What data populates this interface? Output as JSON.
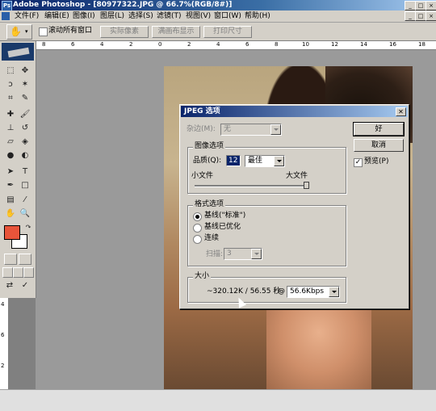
{
  "window": {
    "title": "Adobe Photoshop - [80977322.JPG @ 66.7%(RGB/8#)]"
  },
  "menu": [
    "文件(F)",
    "编辑(E)",
    "图像(I)",
    "图层(L)",
    "选择(S)",
    "滤镜(T)",
    "视图(V)",
    "窗口(W)",
    "帮助(H)"
  ],
  "options": {
    "scroll_all_label": "滚动所有窗口",
    "actual_pixels": "实际像素",
    "fit_on_screen": "满画布显示",
    "print_size": "打印尺寸"
  },
  "ruler": {
    "h_labels": [
      "8",
      "6",
      "4",
      "2",
      "0",
      "2",
      "4",
      "6",
      "8",
      "10",
      "12",
      "14",
      "16",
      "18"
    ],
    "v_labels": [
      "4",
      "6",
      "2"
    ]
  },
  "colors": {
    "foreground": "#e8543a",
    "background": "#ffffff"
  },
  "dialog": {
    "title": "JPEG 选项",
    "matte_label": "杂边(M):",
    "matte_value": "无",
    "image_options": {
      "group_label": "图像选项",
      "quality_label": "品质(Q):",
      "quality_value": "12",
      "quality_preset": "最佳",
      "small_file": "小文件",
      "large_file": "大文件",
      "slider_level": 1.0
    },
    "format_options": {
      "group_label": "格式选项",
      "baseline_standard": "基线(\"标准\")",
      "baseline_optimized": "基线已优化",
      "progressive": "连续",
      "scans_label": "扫描:",
      "scans_value": "3"
    },
    "size": {
      "group_label": "大小",
      "estimate": "~320.12K / 56.55 秒",
      "at": "@",
      "speed": "56.6Kbps"
    },
    "buttons": {
      "ok": "好",
      "cancel": "取消",
      "preview": "预览(P)"
    }
  }
}
